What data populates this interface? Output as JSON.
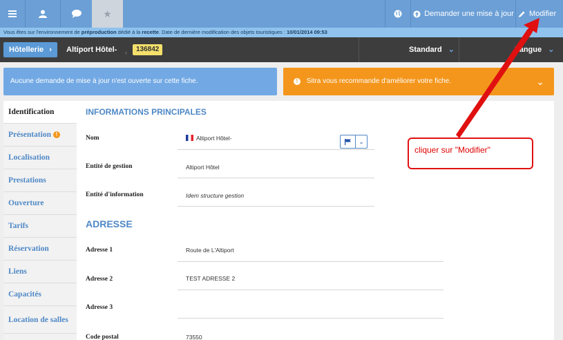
{
  "topbar": {
    "request_update_label": "Demander une mise à jour",
    "modify_label": "Modifier"
  },
  "env": {
    "prefix": "Vous êtes sur l'environnement de ",
    "env_name": "préproduction",
    "middle": " dédié à la ",
    "env_purpose": "recette",
    "suffix": ". Date de dernière modification des objets touristiques : ",
    "date": "10/01/2014 09:53"
  },
  "breadcrumb": {
    "category": "Hôtellerie",
    "object_name": "Altiport Hôtel-",
    "object_id": "136842",
    "view_mode": "Standard",
    "language_label": "Langue"
  },
  "alerts": {
    "left": "Aucune demande de mise à jour n'est ouverte sur cette fiche.",
    "right": "Sitra vous recommande d'améliorer votre fiche."
  },
  "sidebar": {
    "items": [
      {
        "label": "Identification"
      },
      {
        "label": "Présentation"
      },
      {
        "label": "Localisation"
      },
      {
        "label": "Prestations"
      },
      {
        "label": "Ouverture"
      },
      {
        "label": "Tarifs"
      },
      {
        "label": "Réservation"
      },
      {
        "label": "Liens"
      },
      {
        "label": "Capacités"
      },
      {
        "label": "Location de salles"
      }
    ]
  },
  "main": {
    "section_main": "Informations principales",
    "fields_main": [
      {
        "label": "Nom",
        "value": "Altiport Hôtel-"
      },
      {
        "label": "Entité de gestion",
        "value": "Altiport Hôtel"
      },
      {
        "label": "Entité d'information",
        "value": "Idem structure gestion"
      }
    ],
    "section_address": "Adresse",
    "fields_address": [
      {
        "label": "Adresse 1",
        "value": "Route de L'Altiport"
      },
      {
        "label": "Adresse 2",
        "value": "TEST ADRESSE 2"
      },
      {
        "label": "Adresse 3",
        "value": ""
      },
      {
        "label": "Code postal",
        "value": "73550"
      }
    ]
  },
  "annotation": {
    "text": "cliquer sur \"Modifier\""
  },
  "colors": {
    "topbar": "#6b9fd6",
    "env_strip": "#8fc3ee",
    "crumb_bar": "#3d3d3d",
    "alert_info": "#72a9e4",
    "alert_warning": "#f4961c",
    "link_blue": "#4f88c6",
    "annotation_red": "#e01010"
  },
  "icons": {
    "menu": "hamburger-icon",
    "user": "user-icon",
    "chat": "chat-icon",
    "favorite": "star-icon",
    "globe": "globe-icon",
    "request": "arrow-circle-icon",
    "edit": "pencil-icon"
  }
}
